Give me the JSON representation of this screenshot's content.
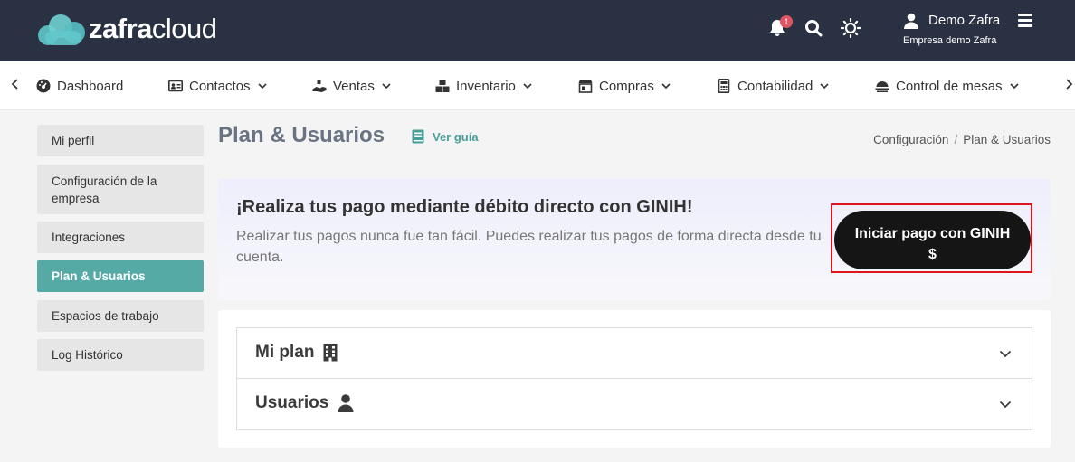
{
  "app": {
    "logo_bold": "zafra",
    "logo_light": "cloud",
    "notification_count": "1",
    "user_name": "Demo Zafra",
    "company": "Empresa demo Zafra"
  },
  "nav": {
    "items": [
      {
        "label": "Dashboard",
        "icon": "dashboard-icon"
      },
      {
        "label": "Contactos",
        "icon": "contacts-icon"
      },
      {
        "label": "Ventas",
        "icon": "sales-icon"
      },
      {
        "label": "Inventario",
        "icon": "inventory-icon"
      },
      {
        "label": "Compras",
        "icon": "store-icon"
      },
      {
        "label": "Contabilidad",
        "icon": "calculator-icon"
      },
      {
        "label": "Control de mesas",
        "icon": "table-service-icon"
      }
    ]
  },
  "sidebar": {
    "items": [
      {
        "label": "Mi perfil"
      },
      {
        "label": "Configuración de la empresa"
      },
      {
        "label": "Integraciones"
      },
      {
        "label": "Plan & Usuarios",
        "active": true
      },
      {
        "label": "Espacios de trabajo"
      },
      {
        "label": "Log Histórico"
      }
    ]
  },
  "page": {
    "title": "Plan & Usuarios",
    "guide_link": "Ver guía",
    "breadcrumb": [
      "Configuración",
      "Plan & Usuarios"
    ]
  },
  "banner": {
    "title": "¡Realiza tus pago mediante débito directo con GINIH!",
    "text": "Realizar tus pagos nunca fue tan fácil. Puedes realizar tus pagos de forma directa desde tu cuenta.",
    "button_line1": "Iniciar pago con GINIH",
    "button_line2": "$"
  },
  "sections": [
    {
      "label": "Mi plan",
      "icon": "building-icon"
    },
    {
      "label": "Usuarios",
      "icon": "user-icon"
    }
  ],
  "colors": {
    "header_bg": "#2a3142",
    "accent": "#56aaa5",
    "highlight_outline": "#e0141c",
    "button_bg": "#151515"
  }
}
